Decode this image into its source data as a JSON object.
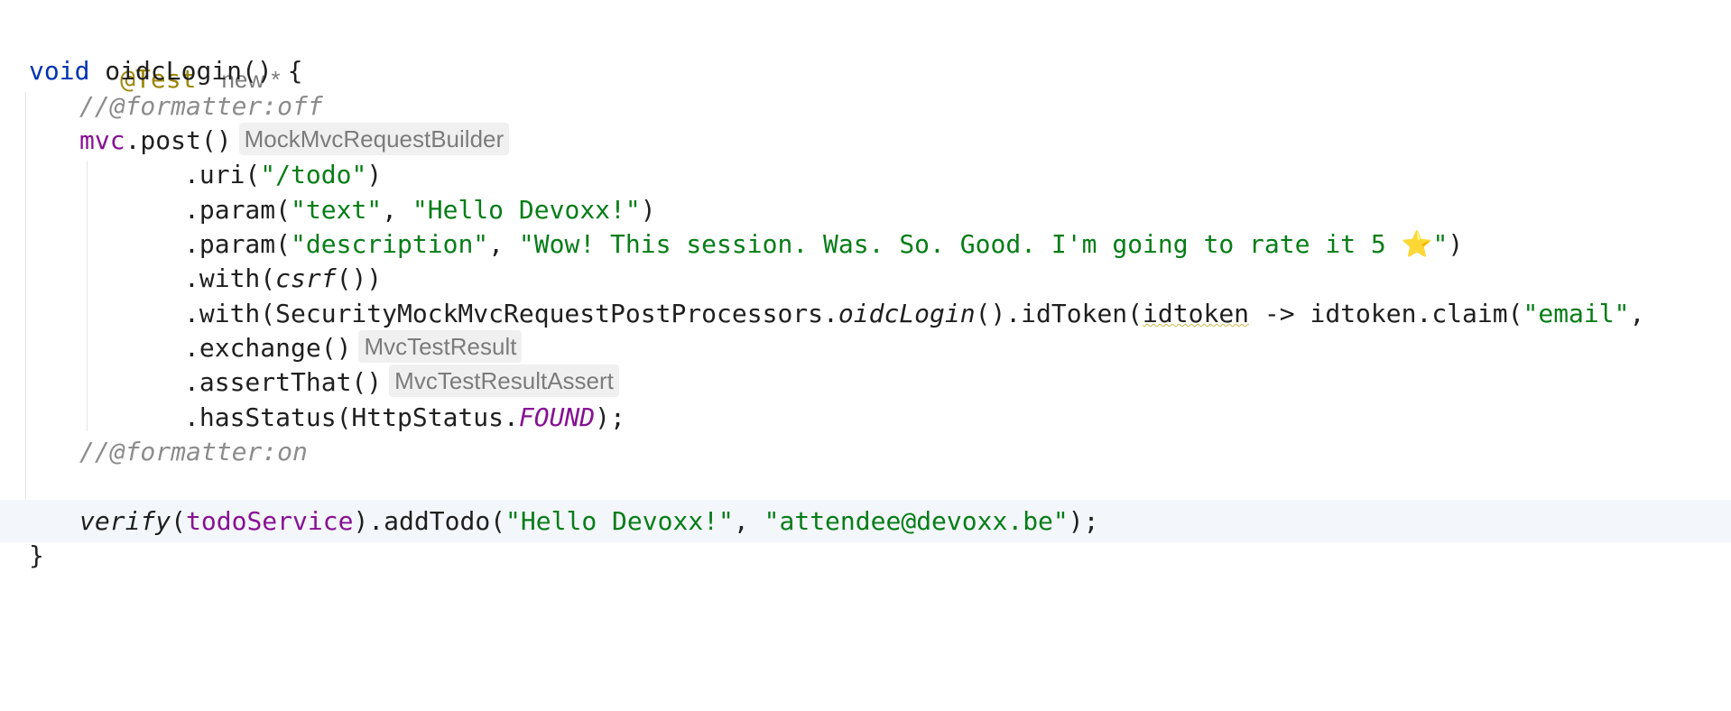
{
  "editor": {
    "author_hint": "new *",
    "lines": {
      "l1_annotation": "@Test",
      "l2_void": "void",
      "l2_method": " oidcLogin() {",
      "l3_comment": "//@formatter:off",
      "l4_field": "mvc",
      "l4_rest": ".post()",
      "l4_hint": "MockMvcRequestBuilder",
      "l5_pre": ".uri(",
      "l5_str": "\"/todo\"",
      "l5_post": ")",
      "l6_pre": ".param(",
      "l6_str1": "\"text\"",
      "l6_mid": ", ",
      "l6_str2": "\"Hello Devoxx!\"",
      "l6_post": ")",
      "l7_pre": ".param(",
      "l7_str1": "\"description\"",
      "l7_mid": ", ",
      "l7_str2": "\"Wow! This session. Was. So. Good. I'm going to rate it 5 ",
      "l7_star": "⭐",
      "l7_str3": "\"",
      "l7_post": ")",
      "l8_pre": ".with(",
      "l8_italic": "csrf",
      "l8_post": "())",
      "l9_pre": ".with(SecurityMockMvcRequestPostProcessors.",
      "l9_italic": "oidcLogin",
      "l9_mid": "().idToken(",
      "l9_squiggle": "idtoken",
      "l9_mid2": " -> idtoken.claim(",
      "l9_str": "\"email\"",
      "l9_post": ",",
      "l10_code": ".exchange()",
      "l10_hint": "MvcTestResult",
      "l11_code": ".assertThat()",
      "l11_hint": "MvcTestResultAssert",
      "l12_pre": ".hasStatus(HttpStatus.",
      "l12_const": "FOUND",
      "l12_post": ");",
      "l13_comment": "//@formatter:on",
      "l15_italic": "verify",
      "l15_mid": "(",
      "l15_field": "todoService",
      "l15_mid2": ").addTodo(",
      "l15_str1": "\"Hello Devoxx!\"",
      "l15_mid3": ", ",
      "l15_str2": "\"attendee@devoxx.be\"",
      "l15_post": ");",
      "l16_brace": "}"
    }
  }
}
